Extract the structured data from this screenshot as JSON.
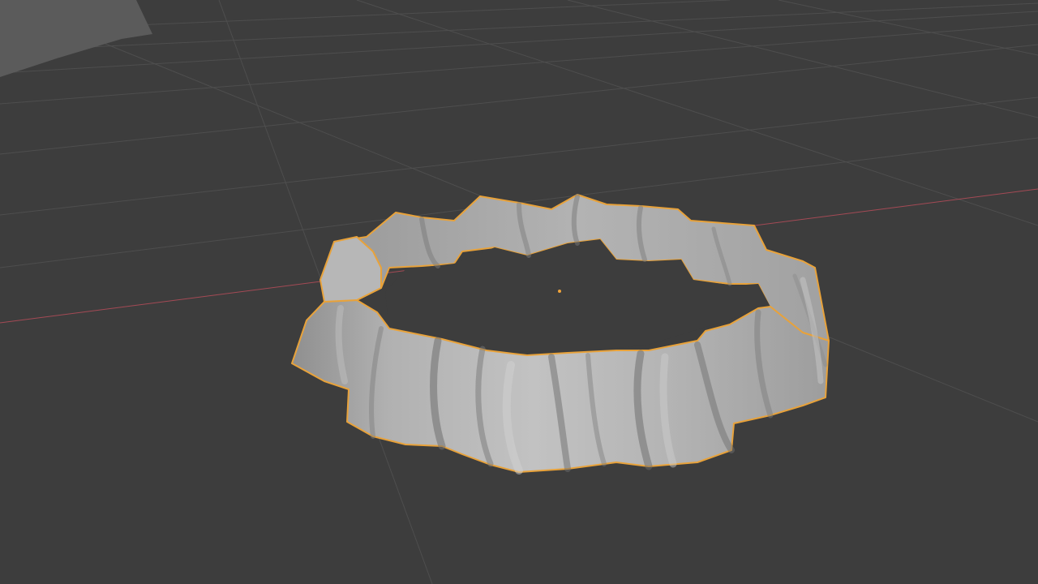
{
  "viewport": {
    "editor": "3D Viewport",
    "background_color": "#3d3d3d",
    "grid_line_color": "#4e4e4e",
    "grid_major_color": "#545454",
    "x_axis_color": "#a44a55",
    "selection_outline_color": "#e8a23a",
    "origin_marker_color": "#f0a43a",
    "mesh_base_color": "#a9a9a9",
    "background_object_color": "#5b5b5b"
  },
  "scene": {
    "active_object": {
      "selected": true,
      "shading": "solid",
      "icon": "ruffled-ring-mesh"
    },
    "other_objects": [
      {
        "icon": "partial-mesh-corner",
        "selected": false
      }
    ],
    "visible_axes": [
      "x-axis"
    ]
  }
}
